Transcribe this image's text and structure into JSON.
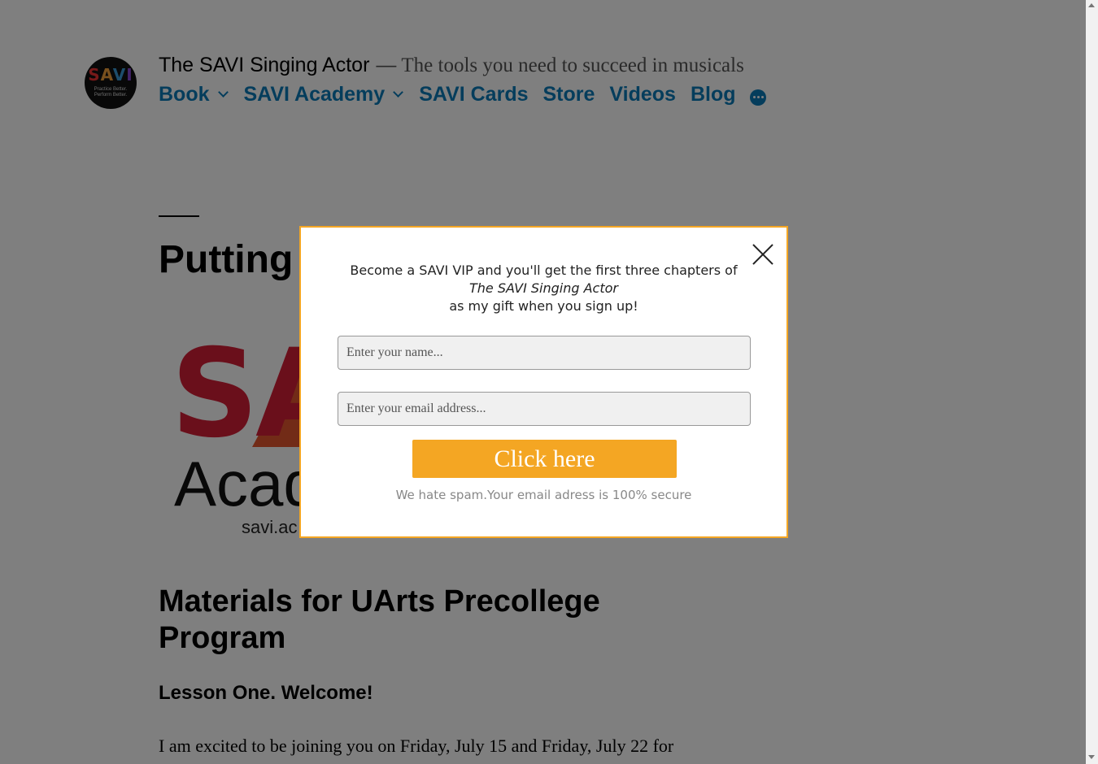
{
  "header": {
    "site_title": "The SAVI Singing Actor",
    "separator": "—",
    "tagline": "The tools you need to succeed in musicals",
    "logo": {
      "word_s": "S",
      "word_a": "A",
      "word_v": "V",
      "word_i": "I",
      "tag_line1": "Practice Better.",
      "tag_line2": "Perform Better."
    }
  },
  "nav": {
    "items": [
      {
        "label": "Book",
        "has_submenu": true
      },
      {
        "label": "SAVI Academy",
        "has_submenu": true
      },
      {
        "label": "SAVI Cards",
        "has_submenu": false
      },
      {
        "label": "Store",
        "has_submenu": false
      },
      {
        "label": "Videos",
        "has_submenu": false
      },
      {
        "label": "Blog",
        "has_submenu": false
      }
    ],
    "more_icon": "more-horizontal-icon",
    "link_color": "#0a7bb8"
  },
  "article": {
    "title": "Putting",
    "image": {
      "big_letters": "SA",
      "academy": "Acad",
      "url": "savi.ac"
    },
    "h2": "Materials for UArts Precollege Program",
    "h3": "Lesson One. Welcome!",
    "paragraph": "I am excited to be joining you on Friday, July 15 and Friday, July 22 for"
  },
  "modal": {
    "line1": "Become a SAVI VIP and you'll get the first three chapters of",
    "book_title": "The SAVI Singing Actor",
    "line3": "as my gift when you sign up!",
    "name_placeholder": "Enter your name...",
    "email_placeholder": "Enter your email address...",
    "button_label": "Click here",
    "spam_note": "We hate spam.Your email adress is 100% secure",
    "close_icon": "close-icon",
    "accent_color": "#f4a623"
  }
}
